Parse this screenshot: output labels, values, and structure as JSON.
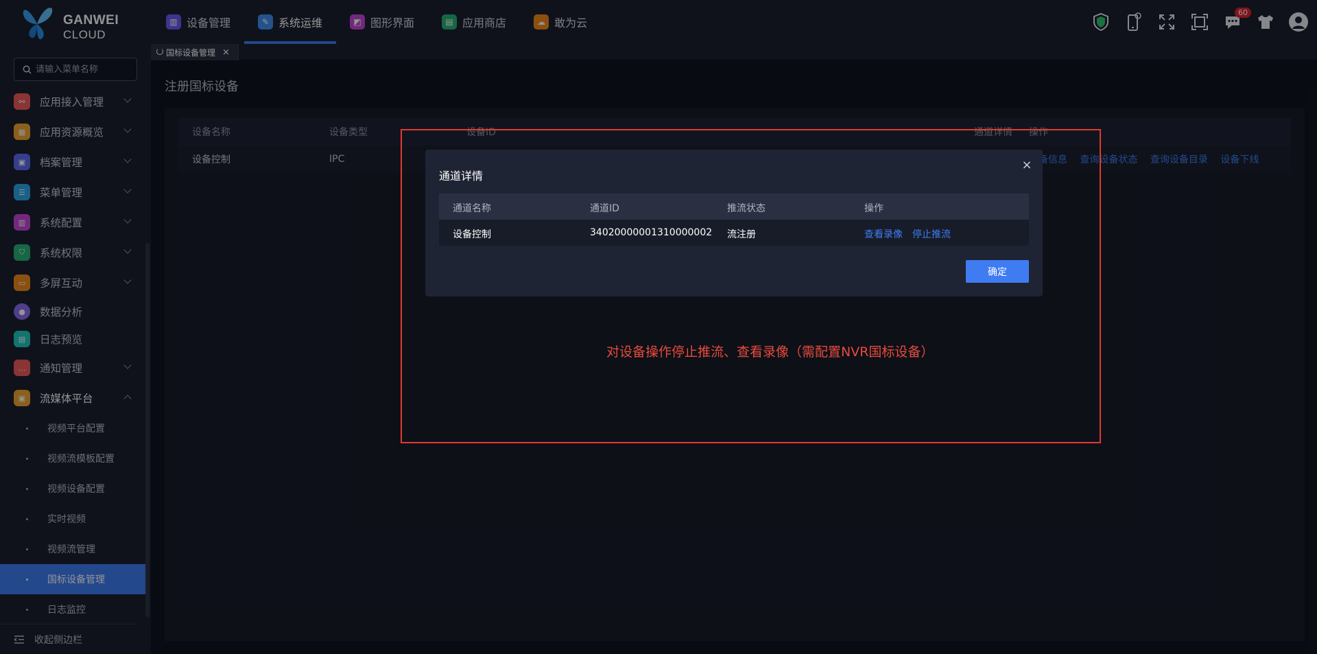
{
  "brand": {
    "line1": "GANWEI",
    "line2": "CLOUD"
  },
  "topnav": [
    {
      "label": "设备管理",
      "icon": "device-icon",
      "color": "#6a5cf0"
    },
    {
      "label": "系统运维",
      "icon": "wrench-icon",
      "color": "#3f8df2",
      "active": true
    },
    {
      "label": "图形界面",
      "icon": "graphic-icon",
      "color": "#c448d6"
    },
    {
      "label": "应用商店",
      "icon": "store-icon",
      "color": "#29b277"
    },
    {
      "label": "敢为云",
      "icon": "cloud-icon",
      "color": "#f08a1c"
    }
  ],
  "topright": {
    "notification_count": "60"
  },
  "sidebar": {
    "search_placeholder": "请输入菜单名称",
    "items": [
      {
        "label": "应用接入管理",
        "color": "#ef5a5a"
      },
      {
        "label": "应用资源概览",
        "color": "#f0a431"
      },
      {
        "label": "档案管理",
        "color": "#5d6cf0"
      },
      {
        "label": "菜单管理",
        "color": "#2ba6e8"
      },
      {
        "label": "系统配置",
        "color": "#c448d6"
      },
      {
        "label": "系统权限",
        "color": "#29b277"
      },
      {
        "label": "多屏互动",
        "color": "#f08a1c"
      },
      {
        "label": "数据分析",
        "color": "#8a6cf0"
      },
      {
        "label": "日志预览",
        "color": "#1fc7c0"
      },
      {
        "label": "通知管理",
        "color": "#ef5a5a"
      },
      {
        "label": "流媒体平台",
        "color": "#f0a431"
      }
    ],
    "subitems": [
      {
        "label": "视频平台配置"
      },
      {
        "label": "视频流模板配置"
      },
      {
        "label": "视频设备配置"
      },
      {
        "label": "实时视频"
      },
      {
        "label": "视频流管理"
      },
      {
        "label": "国标设备管理",
        "active": true
      },
      {
        "label": "日志监控"
      }
    ],
    "collapse_label": "收起侧边栏"
  },
  "tab": {
    "label": "国标设备管理"
  },
  "page": {
    "title": "注册国标设备"
  },
  "table": {
    "headers": [
      "设备名称",
      "设备类型",
      "设备ID",
      "通道详情",
      "操作"
    ],
    "row": {
      "name": "设备控制",
      "type": "IPC",
      "actions": [
        "设备信息",
        "查询设备状态",
        "查询设备目录",
        "设备下线"
      ]
    }
  },
  "modal": {
    "title": "通道详情",
    "headers": [
      "通道名称",
      "通道ID",
      "推流状态",
      "操作"
    ],
    "row": {
      "name": "设备控制",
      "id": "34020000001310000002",
      "status": "流注册",
      "action1": "查看录像",
      "action2": "停止推流"
    },
    "ok_label": "确定"
  },
  "annotation": {
    "text": "对设备操作停止推流、查看录像（需配置NVR国标设备）",
    "color": "#e84a3c"
  }
}
